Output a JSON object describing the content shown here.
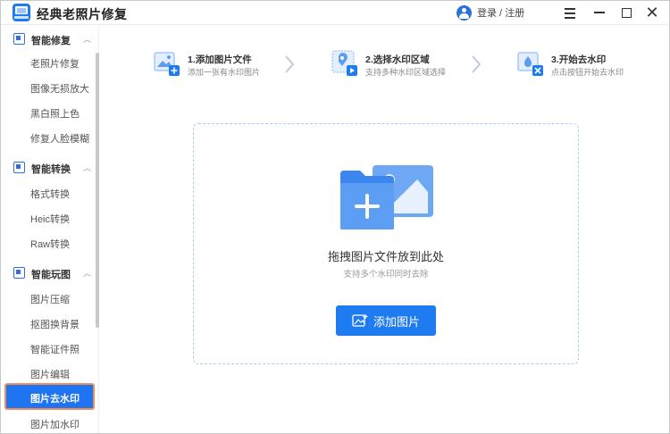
{
  "window": {
    "title": "经典老照片修复",
    "login_label": "登录 / 注册"
  },
  "sidebar": {
    "groups": [
      {
        "label": "智能修复",
        "items": [
          "老照片修复",
          "图像无损放大",
          "黑白照上色",
          "修复人脸模糊"
        ]
      },
      {
        "label": "智能转换",
        "items": [
          "格式转换",
          "Heic转换",
          "Raw转换"
        ]
      },
      {
        "label": "智能玩图",
        "items": [
          "图片压缩",
          "抠图换背景",
          "智能证件照",
          "图片编辑",
          "图片去水印",
          "图片加水印"
        ]
      }
    ],
    "active_item": "图片去水印"
  },
  "steps": [
    {
      "title": "1.添加图片文件",
      "desc": "添加一张有水印图片"
    },
    {
      "title": "2.选择水印区域",
      "desc": "支持多种水印区域选择"
    },
    {
      "title": "3.开始去水印",
      "desc": "点击按钮开始去水印"
    }
  ],
  "dropzone": {
    "title": "拖拽图片文件放到此处",
    "subtitle": "支持多个水印同时去除",
    "button_label": "添加图片"
  },
  "colors": {
    "accent": "#1f7bf0",
    "active_border": "#f28b55",
    "dashed_border": "#a9cdf7"
  }
}
